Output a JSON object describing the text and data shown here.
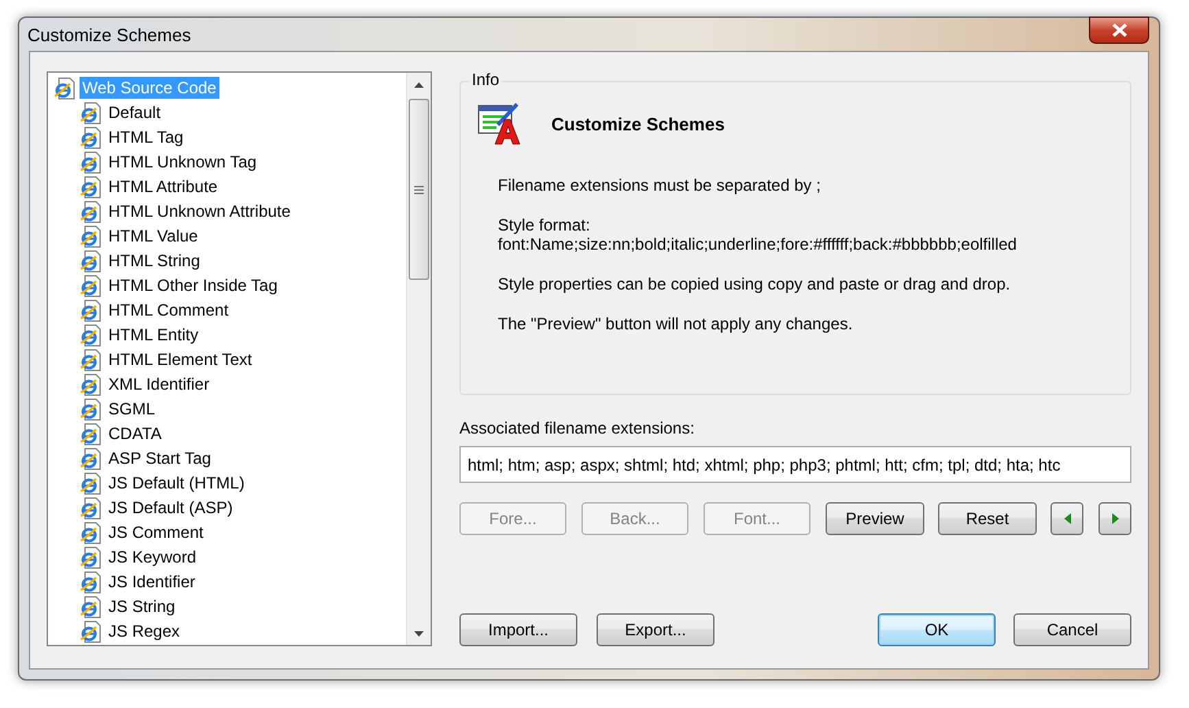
{
  "window": {
    "title": "Customize Schemes"
  },
  "tree": {
    "items": [
      {
        "label": "Web Source Code",
        "selected": true,
        "children": [
          {
            "label": "Default",
            "selected": false
          },
          {
            "label": "HTML Tag",
            "selected": false
          },
          {
            "label": "HTML Unknown Tag",
            "selected": false
          },
          {
            "label": "HTML Attribute",
            "selected": false
          },
          {
            "label": "HTML Unknown Attribute",
            "selected": false
          },
          {
            "label": "HTML Value",
            "selected": false
          },
          {
            "label": "HTML String",
            "selected": false
          },
          {
            "label": "HTML Other Inside Tag",
            "selected": false
          },
          {
            "label": "HTML Comment",
            "selected": false
          },
          {
            "label": "HTML Entity",
            "selected": false
          },
          {
            "label": "HTML Element Text",
            "selected": false
          },
          {
            "label": "XML Identifier",
            "selected": false
          },
          {
            "label": "SGML",
            "selected": false
          },
          {
            "label": "CDATA",
            "selected": false
          },
          {
            "label": "ASP Start Tag",
            "selected": false
          },
          {
            "label": "JS Default (HTML)",
            "selected": false
          },
          {
            "label": "JS Default (ASP)",
            "selected": false
          },
          {
            "label": "JS Comment",
            "selected": false
          },
          {
            "label": "JS Keyword",
            "selected": false
          },
          {
            "label": "JS Identifier",
            "selected": false
          },
          {
            "label": "JS String",
            "selected": false
          },
          {
            "label": "JS Regex",
            "selected": false
          }
        ]
      }
    ]
  },
  "info": {
    "legend": "Info",
    "heading": "Customize Schemes",
    "lines": [
      "Filename extensions must be separated by ;",
      "Style format:\nfont:Name;size:nn;bold;italic;underline;fore:#ffffff;back:#bbbbbb;eolfilled",
      "Style properties can be copied using copy and paste or drag and drop.",
      "The \"Preview\" button will not apply any changes."
    ]
  },
  "extensions": {
    "label": "Associated filename extensions:",
    "value": "html; htm; asp; aspx; shtml; htd; xhtml; php; php3; phtml; htt; cfm; tpl; dtd; hta; htc"
  },
  "style_buttons": [
    {
      "label": "Fore...",
      "disabled": true
    },
    {
      "label": "Back...",
      "disabled": true
    },
    {
      "label": "Font...",
      "disabled": true
    },
    {
      "label": "Preview",
      "disabled": false
    },
    {
      "label": "Reset",
      "disabled": false
    }
  ],
  "nav_buttons": [
    {
      "kind": "previous"
    },
    {
      "kind": "next"
    }
  ],
  "bottom_buttons": [
    {
      "label": "Import...",
      "default": false
    },
    {
      "label": "Export...",
      "default": false
    },
    {
      "label": "OK",
      "default": true
    },
    {
      "label": "Cancel",
      "default": false
    }
  ]
}
